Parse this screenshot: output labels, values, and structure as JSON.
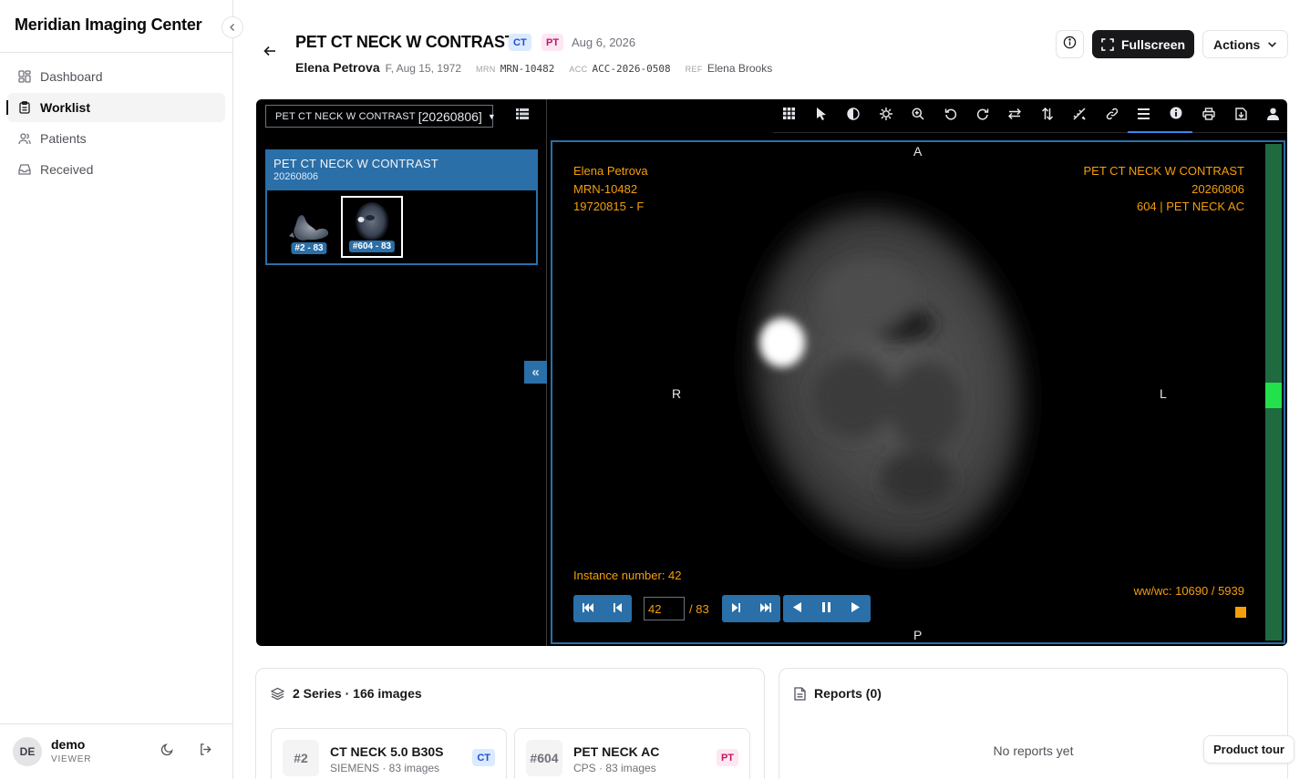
{
  "app": {
    "title": "Meridian Imaging Center"
  },
  "sidebar": {
    "items": [
      {
        "label": "Dashboard",
        "icon": "dashboard-icon",
        "active": false
      },
      {
        "label": "Worklist",
        "icon": "worklist-icon",
        "active": true
      },
      {
        "label": "Patients",
        "icon": "patients-icon",
        "active": false
      },
      {
        "label": "Received",
        "icon": "inbox-icon",
        "active": false
      }
    ],
    "user": {
      "initials": "DE",
      "name": "demo",
      "role": "VIEWER"
    }
  },
  "header": {
    "title": "PET CT NECK W CONTRAST",
    "modalities": [
      "CT",
      "PT"
    ],
    "date": "Aug 6, 2026",
    "patient_name": "Elena Petrova",
    "patient_demo": "F, Aug 15, 1972",
    "mrn_label": "MRN",
    "mrn": "MRN-10482",
    "acc_label": "ACC",
    "acc": "ACC-2026-0508",
    "ref_label": "REF",
    "ref": "Elena Brooks",
    "fullscreen_label": "Fullscreen",
    "actions_label": "Actions"
  },
  "viewer": {
    "study_select": {
      "name": "PET CT NECK W CONTRAST",
      "date": "[20260806]"
    },
    "study_card": {
      "title": "PET CT NECK W CONTRAST",
      "date": "20260806"
    },
    "thumbnails": [
      {
        "label": "#2 - 83",
        "selected": false
      },
      {
        "label": "#604 - 83",
        "selected": true
      }
    ],
    "toggle_label": "«",
    "toolbar": [
      "layout-grid-icon",
      "pointer-icon",
      "contrast-icon",
      "pan-icon",
      "zoom-icon",
      "rotate-left-icon",
      "rotate-right-icon",
      "flip-horizontal-icon",
      "flip-vertical-icon",
      "measure-icon",
      "link-icon",
      "menu-icon",
      "info-icon",
      "print-icon",
      "download-icon",
      "user-icon"
    ],
    "overlay": {
      "tl": [
        "Elena Petrova",
        "MRN-10482",
        "19720815 - F"
      ],
      "tr": [
        "PET CT NECK W CONTRAST",
        "20260806",
        "604 | PET NECK AC"
      ],
      "instance": "Instance number: 42",
      "wwwc": "ww/wc: 10690 / 5939"
    },
    "orientation": {
      "top": "A",
      "bottom": "P",
      "left": "R",
      "right": "L"
    },
    "frame": {
      "current": "42",
      "total": "/ 83",
      "progress": 0.506
    },
    "colors": {
      "accent": "#2a6fa8",
      "overlay": "#f59e0b",
      "scroll": "#1f6b3f",
      "scroll_thumb": "#22e14a"
    }
  },
  "series_panel": {
    "header": "2 Series · 166 images",
    "items": [
      {
        "num": "#2",
        "title": "CT NECK 5.0 B30S",
        "sub": "SIEMENS · 83 images",
        "badge": "CT"
      },
      {
        "num": "#604",
        "title": "PET NECK AC",
        "sub": "CPS · 83 images",
        "badge": "PT"
      }
    ]
  },
  "reports_panel": {
    "header": "Reports (0)",
    "empty": "No reports yet"
  },
  "tour": {
    "label": "Product tour"
  }
}
